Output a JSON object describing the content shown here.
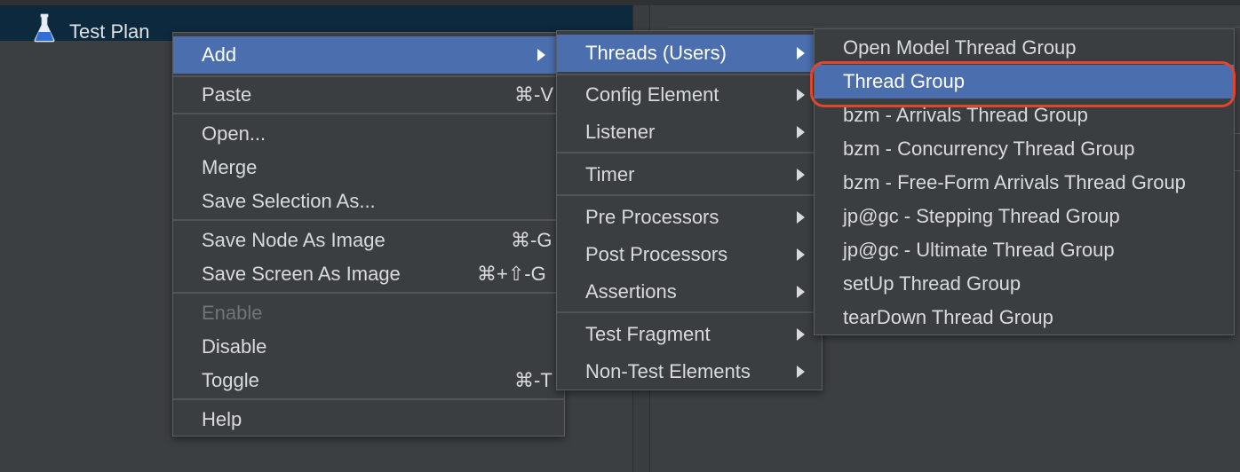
{
  "tree": {
    "root_label": "Test Plan",
    "root_icon": "flask-icon"
  },
  "context_menu": {
    "items": [
      {
        "label": "Add",
        "submenu": true,
        "selected": true
      },
      {
        "label": "Paste",
        "shortcut": "⌘-V"
      },
      {
        "label": "Open..."
      },
      {
        "label": "Merge"
      },
      {
        "label": "Save Selection As..."
      },
      {
        "label": "Save Node As Image",
        "shortcut": "⌘-G"
      },
      {
        "label": "Save Screen As Image",
        "shortcut": "⌘+⇧-G"
      },
      {
        "label": "Enable",
        "disabled": true
      },
      {
        "label": "Disable"
      },
      {
        "label": "Toggle",
        "shortcut": "⌘-T"
      },
      {
        "label": "Help"
      }
    ]
  },
  "add_submenu": {
    "items": [
      {
        "label": "Threads (Users)",
        "selected": true
      },
      {
        "label": "Config Element"
      },
      {
        "label": "Listener"
      },
      {
        "label": "Timer"
      },
      {
        "label": "Pre Processors"
      },
      {
        "label": "Post Processors"
      },
      {
        "label": "Assertions"
      },
      {
        "label": "Test Fragment"
      },
      {
        "label": "Non-Test Elements"
      }
    ]
  },
  "threads_submenu": {
    "items": [
      {
        "label": "Open Model Thread Group"
      },
      {
        "label": "Thread Group",
        "selected": true,
        "annotated": true
      },
      {
        "label": "bzm - Arrivals Thread Group"
      },
      {
        "label": "bzm - Concurrency Thread Group"
      },
      {
        "label": "bzm - Free-Form Arrivals Thread Group"
      },
      {
        "label": "jp@gc - Stepping Thread Group"
      },
      {
        "label": "jp@gc - Ultimate Thread Group"
      },
      {
        "label": "setUp Thread Group"
      },
      {
        "label": "tearDown Thread Group"
      }
    ]
  },
  "colors": {
    "selection": "#4b6eaf",
    "annotation": "#e0452d",
    "tree_selection": "#0d293e"
  }
}
